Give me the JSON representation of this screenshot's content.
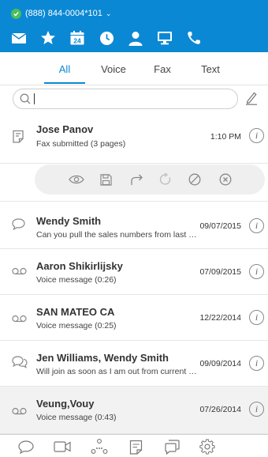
{
  "header": {
    "phone": "(888) 844-0004*101",
    "brand_color": "#0b88d4",
    "icons": [
      "mail-icon",
      "star-icon",
      "calendar-icon",
      "clock-icon",
      "contact-icon",
      "desktop-icon",
      "phone-icon"
    ],
    "calendar_day": "24"
  },
  "tabs": [
    {
      "label": "All",
      "active": true
    },
    {
      "label": "Voice",
      "active": false
    },
    {
      "label": "Fax",
      "active": false
    },
    {
      "label": "Text",
      "active": false
    }
  ],
  "search": {
    "value": "",
    "placeholder": ""
  },
  "messages": [
    {
      "name": "Jose Panov",
      "preview": "Fax submitted (3 pages)",
      "time": "1:10 PM",
      "type": "fax"
    },
    {
      "name": "Wendy Smith",
      "preview": "Can you pull the sales numbers from last …",
      "time": "09/07/2015",
      "type": "text"
    },
    {
      "name": "Aaron Shikirlijsky",
      "preview": "Voice message (0:26)",
      "time": "07/09/2015",
      "type": "voicemail"
    },
    {
      "name": "SAN MATEO  CA",
      "preview": "Voice message (0:25)",
      "time": "12/22/2014",
      "type": "voicemail"
    },
    {
      "name": "Jen Williams, Wendy Smith",
      "preview": "Will join as soon as I am out from current …",
      "time": "09/09/2014",
      "type": "group-text"
    },
    {
      "name": "Veung,Vouy",
      "preview": "Voice message (0:43)",
      "time": "07/26/2014",
      "type": "voicemail"
    }
  ],
  "actions": [
    "view-icon",
    "save-icon",
    "forward-icon",
    "refresh-icon",
    "block-icon",
    "delete-icon"
  ],
  "bottom_bar": [
    "chat-icon",
    "video-icon",
    "conference-icon",
    "notes-icon",
    "messages-icon",
    "settings-icon"
  ]
}
